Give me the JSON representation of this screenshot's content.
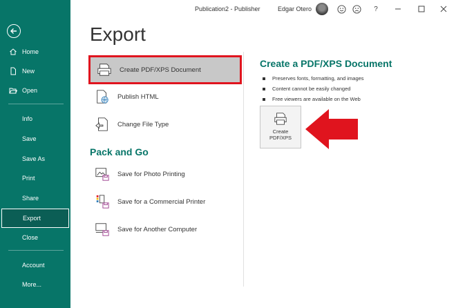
{
  "titlebar": {
    "app_title": "Publication2  -  Publisher",
    "user_name": "Edgar Otero",
    "icons": [
      "smiley-icon",
      "frown-icon",
      "help-icon",
      "minimize-icon",
      "restore-icon",
      "close-icon"
    ],
    "help_label": "?"
  },
  "sidebar": {
    "bg_color": "#077568",
    "items": [
      {
        "label": "Home",
        "icon": "home-icon"
      },
      {
        "label": "New",
        "icon": "new-document-icon"
      },
      {
        "label": "Open",
        "icon": "folder-open-icon"
      },
      {
        "label": "Info"
      },
      {
        "label": "Save"
      },
      {
        "label": "Save As"
      },
      {
        "label": "Print"
      },
      {
        "label": "Share"
      },
      {
        "label": "Export",
        "active": true
      },
      {
        "label": "Close"
      },
      {
        "label": "Account"
      },
      {
        "label": "More..."
      }
    ]
  },
  "main": {
    "title": "Export",
    "options": [
      {
        "label": "Create PDF/XPS Document",
        "icon": "pdf-xps-icon",
        "selected": true
      },
      {
        "label": "Publish HTML",
        "icon": "publish-html-icon"
      },
      {
        "label": "Change File Type",
        "icon": "change-file-type-icon"
      }
    ],
    "pack_and_go": {
      "title": "Pack and Go",
      "options": [
        {
          "label": "Save for Photo Printing",
          "icon": "photo-printing-icon"
        },
        {
          "label": "Save for a Commercial Printer",
          "icon": "commercial-printer-icon"
        },
        {
          "label": "Save for Another Computer",
          "icon": "another-computer-icon"
        }
      ]
    }
  },
  "detail": {
    "title": "Create a PDF/XPS Document",
    "bullets": [
      "Preserves fonts, formatting, and images",
      "Content cannot be easily changed",
      "Free viewers are available on the Web"
    ],
    "button_label_line1": "Create",
    "button_label_line2": "PDF/XPS"
  },
  "colors": {
    "accent": "#077568",
    "highlight_border": "#e0141e",
    "arrow": "#e0141e"
  }
}
